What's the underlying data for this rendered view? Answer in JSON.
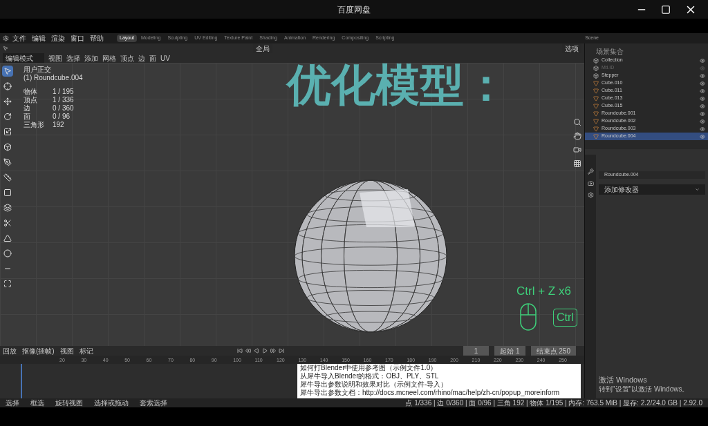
{
  "window": {
    "title": "百度网盘"
  },
  "menu": [
    "文件",
    "编辑",
    "渲染",
    "窗口",
    "帮助"
  ],
  "workspaces": [
    {
      "label": "Layout",
      "selected": true
    },
    {
      "label": "Modeling",
      "selected": false
    },
    {
      "label": "Sculpting",
      "selected": false
    },
    {
      "label": "UV Editing",
      "selected": false
    },
    {
      "label": "Texture Paint",
      "selected": false
    },
    {
      "label": "Shading",
      "selected": false
    },
    {
      "label": "Animation",
      "selected": false
    },
    {
      "label": "Rendering",
      "selected": false
    },
    {
      "label": "Compositing",
      "selected": false
    },
    {
      "label": "Scripting",
      "selected": false
    }
  ],
  "scene": "Scene",
  "viewport": {
    "mode": "编辑模式",
    "header_menu": [
      "视图",
      "选择",
      "添加",
      "网格",
      "顶点",
      "边",
      "面",
      "UV"
    ],
    "orientation": "全局",
    "shading": "选项",
    "view_name": "用户正交",
    "object": "(1) Roundcube.004",
    "stats": [
      {
        "label": "物体",
        "value": "1 / 195"
      },
      {
        "label": "顶点",
        "value": "1 / 336"
      },
      {
        "label": "边",
        "value": "0 / 360"
      },
      {
        "label": "面",
        "value": "0 / 96"
      },
      {
        "label": "三角形",
        "value": "192"
      }
    ],
    "overlay_title": "优化模型：",
    "shortcut": "Ctrl + Z x6",
    "key": "Ctrl"
  },
  "outliner": {
    "title": "场景集合",
    "items": [
      {
        "name": "Collection",
        "kind": "collection",
        "selected": false,
        "disabled": false
      },
      {
        "name": "Mtl.ID",
        "kind": "collection",
        "selected": false,
        "disabled": true
      },
      {
        "name": "Stepper",
        "kind": "collection",
        "selected": false,
        "disabled": false
      },
      {
        "name": "Cube.010",
        "kind": "mesh",
        "selected": false,
        "disabled": false
      },
      {
        "name": "Cube.011",
        "kind": "mesh",
        "selected": false,
        "disabled": false
      },
      {
        "name": "Cube.013",
        "kind": "mesh",
        "selected": false,
        "disabled": false
      },
      {
        "name": "Cube.015",
        "kind": "mesh",
        "selected": false,
        "disabled": false
      },
      {
        "name": "Roundcube.001",
        "kind": "mesh",
        "selected": false,
        "disabled": false
      },
      {
        "name": "Roundcube.002",
        "kind": "mesh",
        "selected": false,
        "disabled": false
      },
      {
        "name": "Roundcube.003",
        "kind": "mesh",
        "selected": false,
        "disabled": false
      },
      {
        "name": "Roundcube.004",
        "kind": "mesh",
        "selected": true,
        "disabled": false
      }
    ]
  },
  "properties": {
    "object": "Roundcube.004",
    "add_modifier": "添加修改器"
  },
  "timeline": {
    "menu": [
      "回放",
      "抠像(插帧)",
      "视图",
      "标记"
    ],
    "ticks": [
      "20",
      "30",
      "40",
      "50",
      "60",
      "70",
      "80",
      "90",
      "100",
      "110",
      "120",
      "130",
      "140",
      "150",
      "160",
      "170",
      "180",
      "190",
      "200",
      "210",
      "220",
      "230",
      "240",
      "250"
    ],
    "frame": "1",
    "start_label": "起始",
    "start": "1",
    "end_label": "结束点",
    "end": "250"
  },
  "status_bar": {
    "left": [
      "选择",
      "框选",
      "旋转视图",
      "选择或拖动",
      "套索选择"
    ],
    "stats": "点 1/336 | 边 0/360 | 面 0/96 | 三角 192 | 物体 1/195 | 内存: 763.5 MiB | 显存: 2.2/24.0 GB | 2.92.0"
  },
  "document": {
    "lines": [
      "如何打Blender中使用参考图（示例文件1.0）",
      "从犀牛导入Blender的格式：OBJ、PLY、STL",
      "犀牛导出参数说明和效果对比（示例文件-导入）",
      "犀牛导出参数文档：http://docs.mcneel.com/rhino/mac/help/zh-cn/popup_moreinform"
    ]
  },
  "activation": {
    "title": "激活 Windows",
    "hint": "转到\"设置\"以激活 Windows。"
  }
}
